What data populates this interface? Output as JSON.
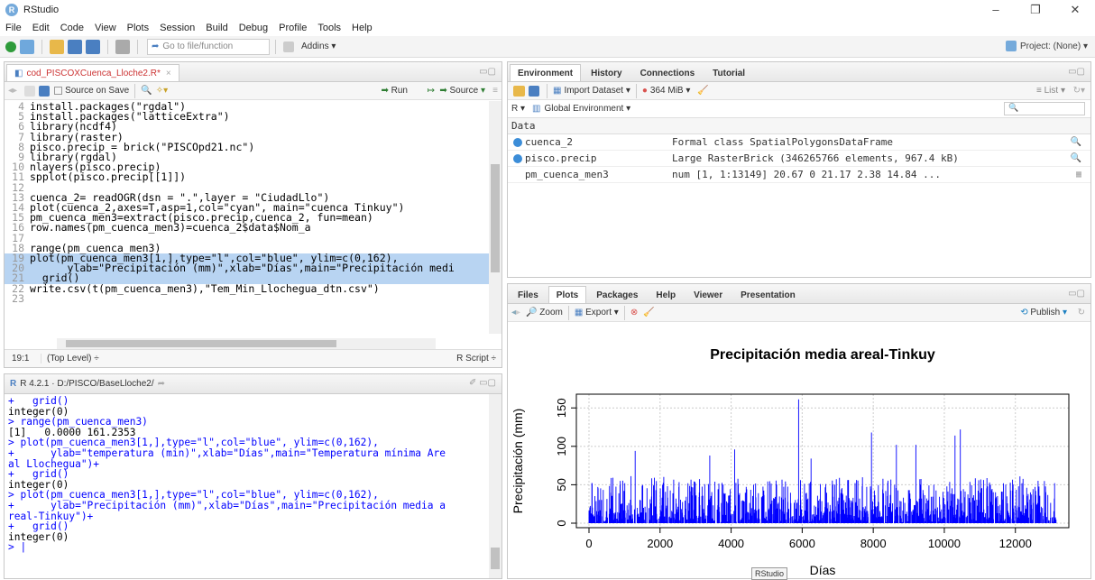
{
  "window": {
    "title": "RStudio",
    "minimize": "–",
    "restore": "❐",
    "close": "✕"
  },
  "menu": [
    "File",
    "Edit",
    "Code",
    "View",
    "Plots",
    "Session",
    "Build",
    "Debug",
    "Profile",
    "Tools",
    "Help"
  ],
  "toolbar": {
    "goto_placeholder": "Go to file/function",
    "addins": "Addins",
    "project": "Project: (None)"
  },
  "editor": {
    "tab": "cod_PISCOXCuenca_Lloche2.R*",
    "source_on_save": "Source on Save",
    "run": "Run",
    "source": "Source",
    "lines": [
      {
        "n": "4",
        "t": "install.packages(\"rgdal\")"
      },
      {
        "n": "5",
        "t": "install.packages(\"latticeExtra\")"
      },
      {
        "n": "6",
        "t": "library(ncdf4)"
      },
      {
        "n": "7",
        "t": "library(raster)"
      },
      {
        "n": "8",
        "t": "pisco.precip = brick(\"PISCOpd21.nc\")"
      },
      {
        "n": "9",
        "t": "library(rgdal)"
      },
      {
        "n": "10",
        "t": "nlayers(pisco.precip)"
      },
      {
        "n": "11",
        "t": "spplot(pisco.precip[[1]])"
      },
      {
        "n": "12",
        "t": ""
      },
      {
        "n": "13",
        "t": "cuenca_2= readOGR(dsn = \".\",layer = \"CiudadLlo\")"
      },
      {
        "n": "14",
        "t": "plot(cuenca_2,axes=T,asp=1,col=\"cyan\", main=\"cuenca Tinkuy\")"
      },
      {
        "n": "15",
        "t": "pm_cuenca_men3=extract(pisco.precip,cuenca_2, fun=mean)"
      },
      {
        "n": "16",
        "t": "row.names(pm_cuenca_men3)=cuenca_2$data$Nom_a"
      },
      {
        "n": "17",
        "t": ""
      },
      {
        "n": "18",
        "t": "range(pm_cuenca_men3)"
      },
      {
        "n": "19",
        "t": "plot(pm_cuenca_men3[1,],type=\"l\",col=\"blue\", ylim=c(0,162),"
      },
      {
        "n": "20",
        "t": "      ylab=\"Precipitación (mm)\",xlab=\"Días\",main=\"Precipitación medi"
      },
      {
        "n": "21",
        "t": "  grid()"
      },
      {
        "n": "22",
        "t": "write.csv(t(pm_cuenca_men3),\"Tem_Min_Llochegua_dtn.csv\")"
      },
      {
        "n": "23",
        "t": ""
      }
    ],
    "status_pos": "19:1",
    "status_scope": "(Top Level) ÷",
    "status_type": "R Script ÷"
  },
  "console": {
    "header": "R 4.2.1 · D:/PISCO/BaseLloche2/",
    "lines": [
      {
        "c": "in",
        "t": "+   grid()"
      },
      {
        "c": "out",
        "t": "integer(0)"
      },
      {
        "c": "in",
        "t": "> range(pm_cuenca_men3)"
      },
      {
        "c": "out",
        "t": "[1]   0.0000 161.2353"
      },
      {
        "c": "in",
        "t": "> plot(pm_cuenca_men3[1,],type=\"l\",col=\"blue\", ylim=c(0,162),"
      },
      {
        "c": "in",
        "t": "+      ylab=\"temperatura (min)\",xlab=\"Días\",main=\"Temperatura mínima Are"
      },
      {
        "c": "in",
        "t": "al Llochegua\")+"
      },
      {
        "c": "in",
        "t": "+   grid()"
      },
      {
        "c": "out",
        "t": "integer(0)"
      },
      {
        "c": "in",
        "t": "> plot(pm_cuenca_men3[1,],type=\"l\",col=\"blue\", ylim=c(0,162),"
      },
      {
        "c": "in",
        "t": "+      ylab=\"Precipitación (mm)\",xlab=\"Días\",main=\"Precipitación media a"
      },
      {
        "c": "in",
        "t": "real-Tinkuy\")+"
      },
      {
        "c": "in",
        "t": "+   grid()"
      },
      {
        "c": "out",
        "t": "integer(0)"
      },
      {
        "c": "in",
        "t": "> |"
      }
    ]
  },
  "env_pane": {
    "tabs": [
      "Environment",
      "History",
      "Connections",
      "Tutorial"
    ],
    "import": "Import Dataset",
    "memory": "364 MiB",
    "list": "List",
    "scope_r": "R",
    "scope": "Global Environment",
    "section": "Data",
    "rows": [
      {
        "name": "cuenca_2",
        "value": "Formal class  SpatialPolygonsDataFrame",
        "dot": true
      },
      {
        "name": "pisco.precip",
        "value": "Large RasterBrick (346265766 elements,  967.4 kB)",
        "dot": true
      },
      {
        "name": "pm_cuenca_men3",
        "value": "num [1, 1:13149] 20.67 0 21.17 2.38 14.84 ...",
        "dot": false
      }
    ]
  },
  "files_pane": {
    "tabs": [
      "Files",
      "Plots",
      "Packages",
      "Help",
      "Viewer",
      "Presentation"
    ],
    "zoom": "Zoom",
    "export": "Export",
    "publish": "Publish",
    "tooltip": "RStudio"
  },
  "colors": {
    "series": "#0000ff",
    "highlight": "#b8d4f2",
    "accent": "#75aadb"
  },
  "chart_data": {
    "type": "line",
    "title": "Precipitación media areal-Tinkuy",
    "xlabel": "Días",
    "ylabel": "Precipitación (mm)",
    "xlim": [
      0,
      13149
    ],
    "ylim": [
      0,
      162
    ],
    "xticks": [
      0,
      2000,
      4000,
      6000,
      8000,
      10000,
      12000
    ],
    "yticks": [
      0,
      50,
      100,
      150
    ],
    "grid": true,
    "peaks": [
      {
        "x": 5900,
        "y": 161.2
      },
      {
        "x": 7950,
        "y": 118
      },
      {
        "x": 10300,
        "y": 114
      },
      {
        "x": 10450,
        "y": 122
      },
      {
        "x": 8650,
        "y": 102
      },
      {
        "x": 9200,
        "y": 102
      },
      {
        "x": 4100,
        "y": 96
      },
      {
        "x": 1300,
        "y": 94
      },
      {
        "x": 3400,
        "y": 88
      },
      {
        "x": 6250,
        "y": 84
      }
    ]
  }
}
